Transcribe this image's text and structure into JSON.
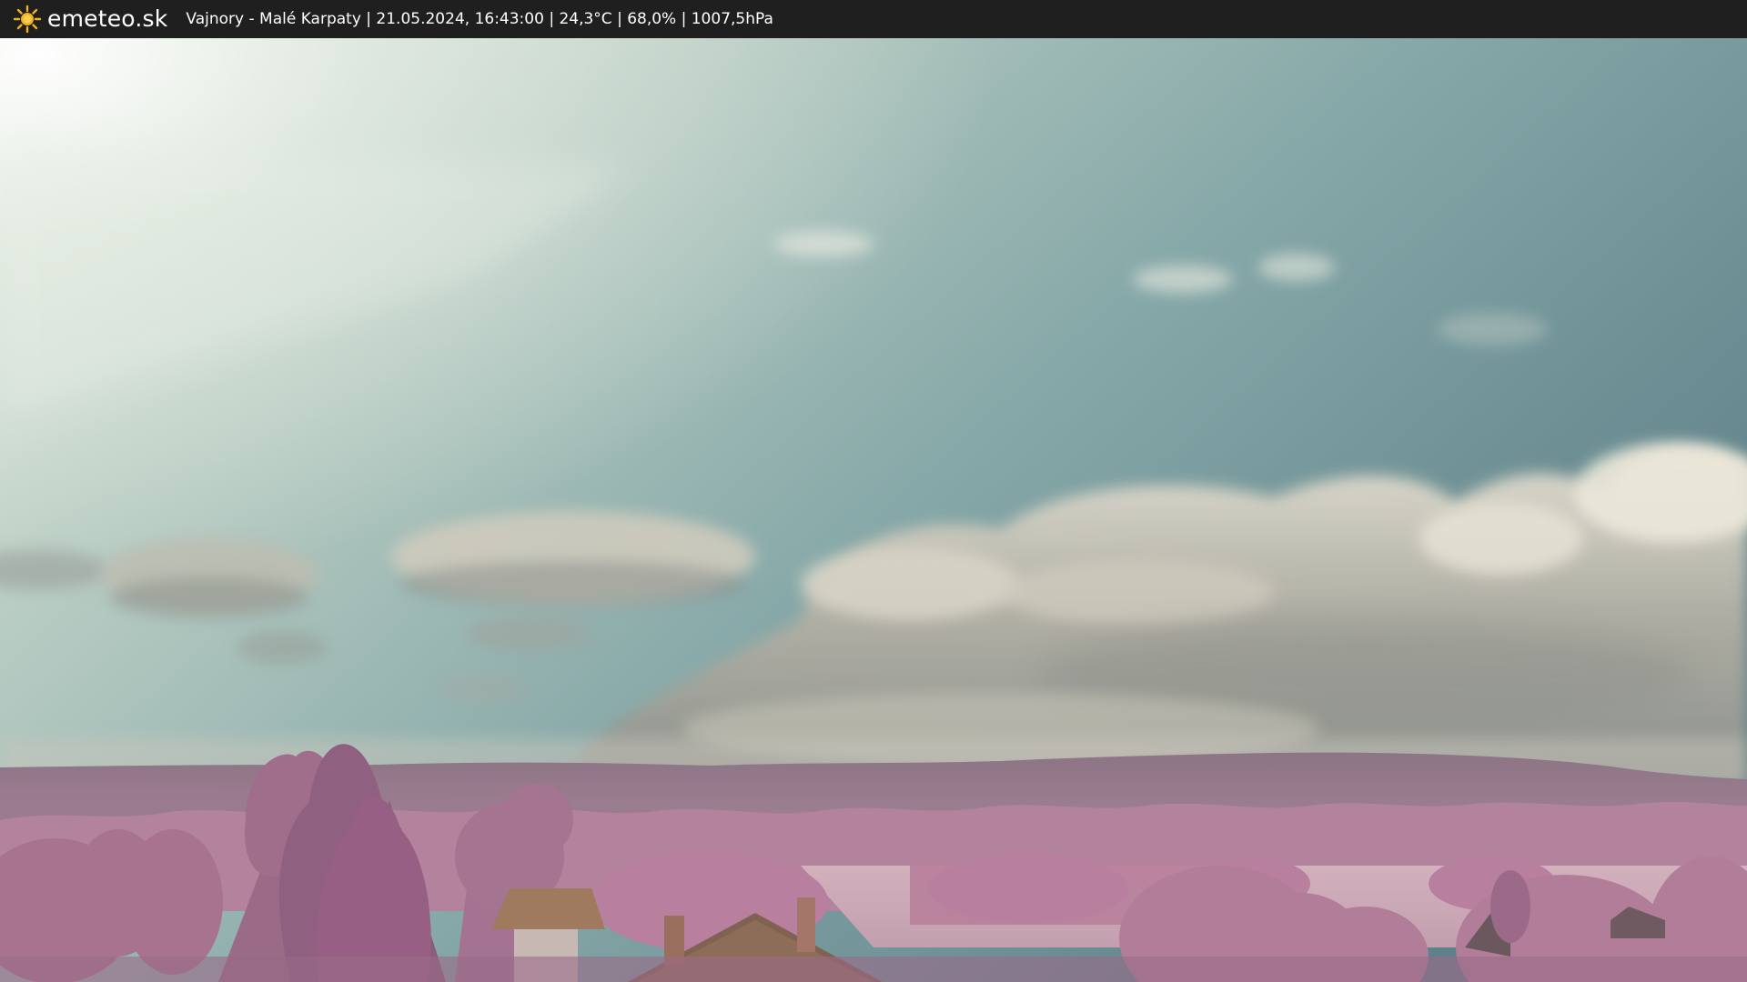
{
  "header": {
    "brand": "emeteo.sk",
    "caption": "Vajnory - Malé Karpaty | 21.05.2024, 16:43:00 | 24,3°C | 68,0% | 1007,5hPa",
    "icon": "sun-icon",
    "bar_color": "#1f1f1f",
    "sun_color": "#f2b21c"
  },
  "scene": {
    "sky_color": "#8fb0ad",
    "cloud_color": "#d6d2c4",
    "hills_color": "#8a6f82",
    "foliage_color": "#b47e9a",
    "field_color": "#c9a7b3",
    "roof_color": "#8a6a52"
  }
}
